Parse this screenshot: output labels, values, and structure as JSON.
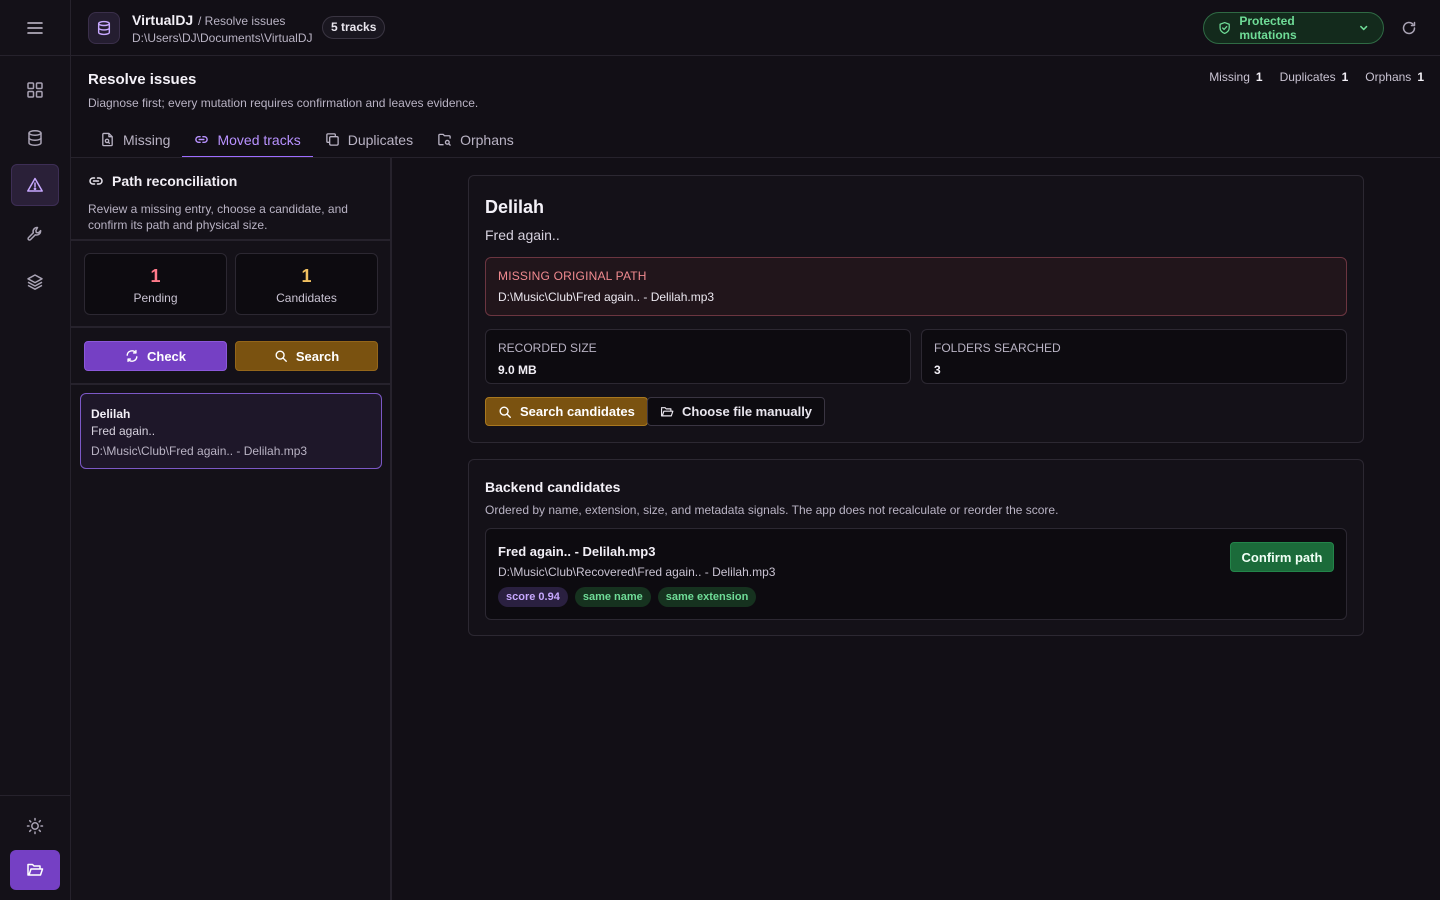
{
  "app": {
    "name": "VirtualDJ",
    "breadcrumb": "/ Resolve issues",
    "path": "D:\\Users\\DJ\\Documents\\VirtualDJ",
    "tracks_chip": "5 tracks",
    "protected_label": "Protected mutations"
  },
  "page": {
    "title": "Resolve issues",
    "subtitle": "Diagnose first; every mutation requires confirmation and leaves evidence.",
    "counts": [
      {
        "label": "Missing",
        "value": "1"
      },
      {
        "label": "Duplicates",
        "value": "1"
      },
      {
        "label": "Orphans",
        "value": "1"
      }
    ],
    "tabs": [
      {
        "label": "Missing",
        "icon": "file-search-icon",
        "active": false
      },
      {
        "label": "Moved tracks",
        "icon": "link-icon",
        "active": true
      },
      {
        "label": "Duplicates",
        "icon": "copy-icon",
        "active": false
      },
      {
        "label": "Orphans",
        "icon": "folder-search-icon",
        "active": false
      }
    ]
  },
  "rail": {
    "items": [
      "dashboard-icon",
      "database-icon",
      "alert-triangle-icon",
      "wrench-icon",
      "layers-icon"
    ],
    "active": "alert-triangle-icon",
    "bottom": [
      "sun-icon",
      "folder-open-icon"
    ]
  },
  "left_panel": {
    "title": "Path reconciliation",
    "description": "Review a missing entry, choose a candidate, and confirm its path and physical size.",
    "stats": [
      {
        "value": "1",
        "label": "Pending",
        "color": "#ff7a8a"
      },
      {
        "value": "1",
        "label": "Candidates",
        "color": "#f0c060"
      }
    ],
    "check_label": "Check",
    "search_label": "Search",
    "issue": {
      "title": "Delilah",
      "artist": "Fred again..",
      "path": "D:\\Music\\Club\\Fred again.. - Delilah.mp3"
    }
  },
  "detail": {
    "title": "Delilah",
    "artist": "Fred again..",
    "missing_label": "MISSING ORIGINAL PATH",
    "missing_path": "D:\\Music\\Club\\Fred again.. - Delilah.mp3",
    "recorded_size_label": "RECORDED SIZE",
    "recorded_size": "9.0 MB",
    "folders_label": "FOLDERS SEARCHED",
    "folders": "3",
    "search_candidates_label": "Search candidates",
    "choose_manual_label": "Choose file manually"
  },
  "candidates": {
    "title": "Backend candidates",
    "subtitle": "Ordered by name, extension, size, and metadata signals. The app does not recalculate or reorder the score.",
    "items": [
      {
        "name": "Fred again.. - Delilah.mp3",
        "path": "D:\\Music\\Club\\Recovered\\Fred again.. - Delilah.mp3",
        "score": "score 0.94",
        "signals": [
          "same name",
          "same extension"
        ],
        "confirm_label": "Confirm path"
      }
    ]
  },
  "colors": {
    "accent": "#7540c4",
    "tab_active": "#b892ff",
    "amber": "#7a5210",
    "success": "#1b6b3a",
    "danger": "#f08a8f"
  }
}
